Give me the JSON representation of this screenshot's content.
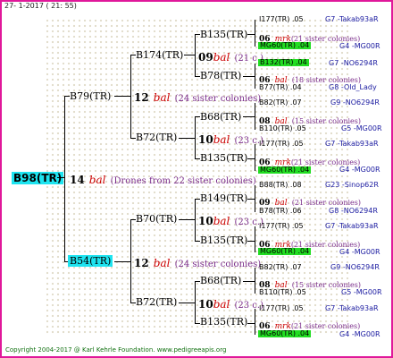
{
  "date": "27-  1-2017 ( 21: 55)",
  "copyright": "Copyright 2004-2017 @ Karl Kehrle Foundation.   www.pedigreeapis.org",
  "root": {
    "id": "B98(TR)",
    "num": "14",
    "unit": "bal",
    "note": "(Drones from 22 sister colonies)"
  },
  "gen1": [
    {
      "id": "B79(TR)",
      "num": "12",
      "unit": "bal",
      "note": "(24 sister colonies)"
    },
    {
      "id": "B54(TR)",
      "num": "12",
      "unit": "bal",
      "note": "(24 sister colonies)"
    }
  ],
  "gen2": [
    {
      "id": "B174(TR)",
      "num": "09",
      "unit": "bal",
      "note": "(21 c.)"
    },
    {
      "id": "B72(TR)",
      "num": "10",
      "unit": "bal",
      "note": "(23 c.)"
    },
    {
      "id": "B70(TR)",
      "num": "10",
      "unit": "bal",
      "note": "(23 c.)"
    },
    {
      "id": "B72(TR)",
      "num": "10",
      "unit": "bal",
      "note": "(23 c.)"
    }
  ],
  "gen3": [
    {
      "id": "B135(TR)",
      "num": "06",
      "unit": "mrk",
      "note": "(21 sister colonies)"
    },
    {
      "id": "B78(TR)",
      "num": "06",
      "unit": "bal",
      "note": "(18 sister colonies)"
    },
    {
      "id": "B68(TR)",
      "num": "08",
      "unit": "bal",
      "note": "(15 sister colonies)"
    },
    {
      "id": "B135(TR)",
      "num": "06",
      "unit": "mrk",
      "note": "(21 sister colonies)"
    },
    {
      "id": "B149(TR)",
      "num": "09",
      "unit": "bal",
      "note": "(21 sister colonies)"
    },
    {
      "id": "B135(TR)",
      "num": "06",
      "unit": "mrk",
      "note": "(21 sister colonies)"
    },
    {
      "id": "B68(TR)",
      "num": "08",
      "unit": "bal",
      "note": "(15 sister colonies)"
    },
    {
      "id": "B135(TR)",
      "num": "06",
      "unit": "mrk",
      "note": "(21 sister colonies)"
    }
  ],
  "gen4": [
    {
      "id": "I177(TR) .05",
      "ref": "G7 -Takab93aR",
      "green": false
    },
    {
      "id": "MG60(TR) .04",
      "ref": "G4 -MG00R",
      "green": true
    },
    {
      "id": "B132(TR) .04",
      "ref": "G7 -NO6294R",
      "green": true
    },
    {
      "id": "B77(TR) .04",
      "ref": "G8 -Old_Lady",
      "green": false
    },
    {
      "id": "B82(TR) .07",
      "ref": "G9 -NO6294R",
      "green": false
    },
    {
      "id": "B110(TR) .05",
      "ref": "G5 -MG00R",
      "green": false
    },
    {
      "id": "I177(TR) .05",
      "ref": "G7 -Takab93aR",
      "green": false
    },
    {
      "id": "MG60(TR) .04",
      "ref": "G4 -MG00R",
      "green": true
    },
    {
      "id": "B88(TR) .08",
      "ref": "G23 -Sinop62R",
      "green": false
    },
    {
      "id": "B78(TR) .06",
      "ref": "G8 -NO6294R",
      "green": false
    },
    {
      "id": "I177(TR) .05",
      "ref": "G7 -Takab93aR",
      "green": false
    },
    {
      "id": "MG60(TR) .04",
      "ref": "G4 -MG00R",
      "green": true
    },
    {
      "id": "B82(TR) .07",
      "ref": "G9 -NO6294R",
      "green": false
    },
    {
      "id": "B110(TR) .05",
      "ref": "G5 -MG00R",
      "green": false
    },
    {
      "id": "I177(TR) .05",
      "ref": "G7 -Takab93aR",
      "green": false
    },
    {
      "id": "MG60(TR) .04",
      "ref": "G4 -MG00R",
      "green": true
    }
  ]
}
